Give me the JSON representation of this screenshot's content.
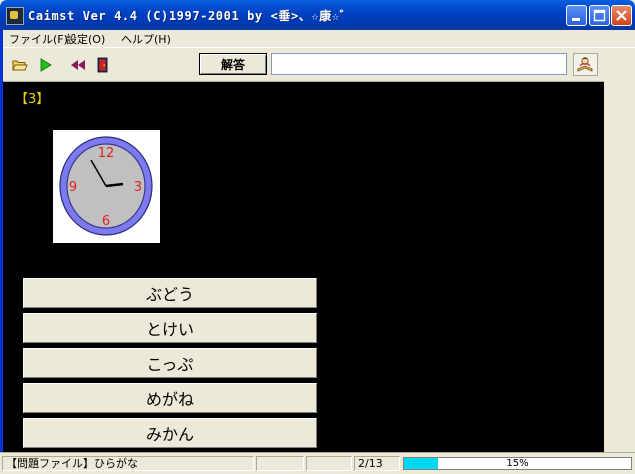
{
  "window": {
    "title": "Caimst Ver 4.4 (C)1997-2001  by <垂>、☆康☆゛"
  },
  "menu": {
    "items": [
      {
        "label": "ファイル(F)"
      },
      {
        "label": "設定(O)"
      },
      {
        "label": "ヘルプ(H)"
      }
    ]
  },
  "toolbar": {
    "answer_label": "解答",
    "answer_value": "",
    "icons": [
      "open-folder-icon",
      "play-icon",
      "rewind-icon",
      "exit-door-icon",
      "help-book-icon"
    ]
  },
  "question": {
    "number": "【3】",
    "picture": {
      "type": "clock",
      "numerals": [
        "12",
        "3",
        "6",
        "9"
      ],
      "colors": {
        "face": "#c0c0c0",
        "rim": "#7b7bee",
        "numerals": "#e02020",
        "hands": "#000000"
      }
    }
  },
  "choices": [
    {
      "label": "ぶどう"
    },
    {
      "label": "とけい"
    },
    {
      "label": "こっぷ"
    },
    {
      "label": "めがね"
    },
    {
      "label": "みかん"
    }
  ],
  "status": {
    "file": "【問題ファイル】ひらがな",
    "count": "2/13",
    "progress_percent": 15,
    "progress_text": "15%"
  },
  "colors": {
    "background": "#000000",
    "question_number": "#e8d000",
    "progress_fill": "#00d8f0",
    "titlebar": "#0042c4"
  }
}
